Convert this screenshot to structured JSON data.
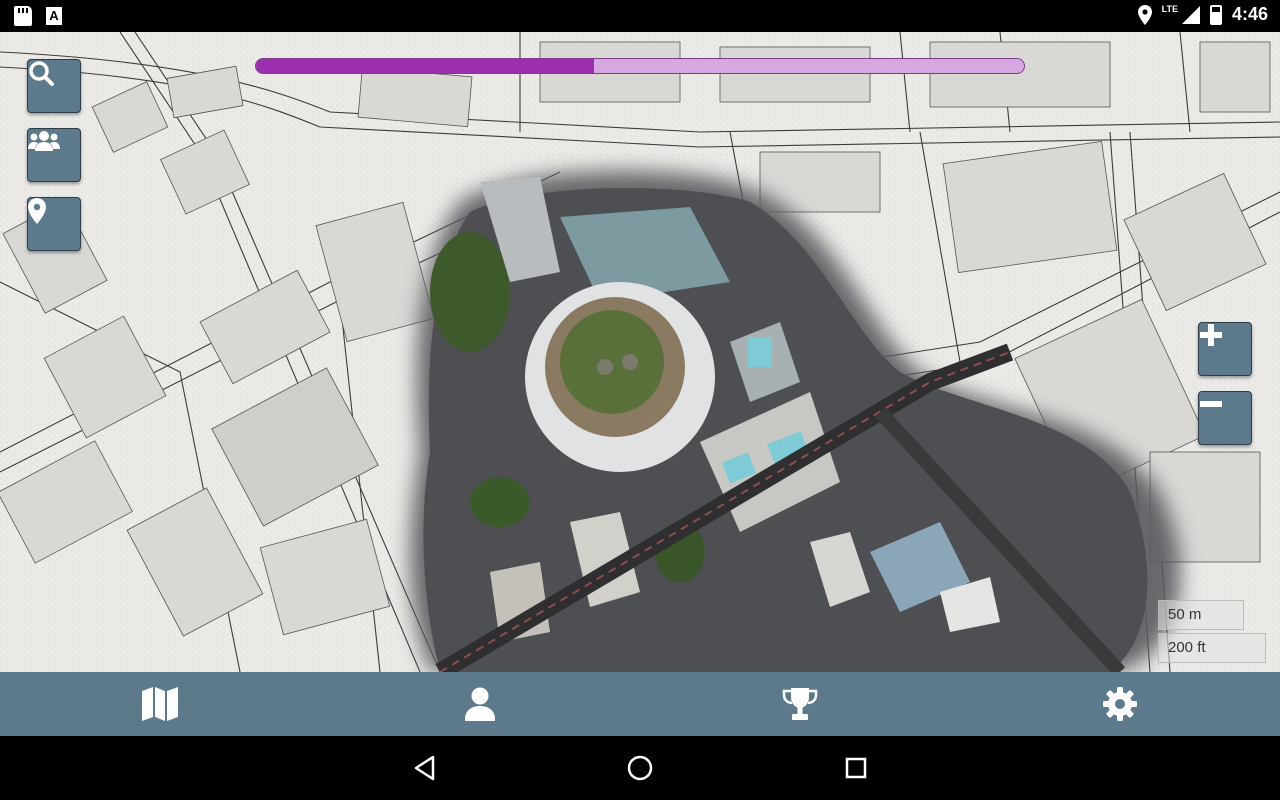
{
  "status_bar": {
    "time": "4:46",
    "network": "LTE",
    "icons": [
      "sd-card-icon",
      "a-icon",
      "location-icon",
      "signal-icon",
      "battery-icon"
    ]
  },
  "map": {
    "buttons": {
      "search": "search-icon",
      "group": "users-icon",
      "pin": "map-pin-icon",
      "zoom_in": "plus-icon",
      "zoom_out": "minus-icon"
    },
    "progress": {
      "value": 0.44,
      "fill_color": "#9b2fb0",
      "track_color": "#d7a7e1"
    },
    "scale": {
      "metric": "50 m",
      "imperial": "200 ft"
    }
  },
  "bottom_nav": {
    "items": [
      {
        "icon": "map-icon",
        "active": true
      },
      {
        "icon": "user-icon",
        "active": false
      },
      {
        "icon": "trophy-icon",
        "active": false
      },
      {
        "icon": "gear-icon",
        "active": false
      }
    ],
    "color": "#5d7a8c"
  },
  "android_nav": [
    "back-icon",
    "home-icon",
    "recents-icon"
  ]
}
